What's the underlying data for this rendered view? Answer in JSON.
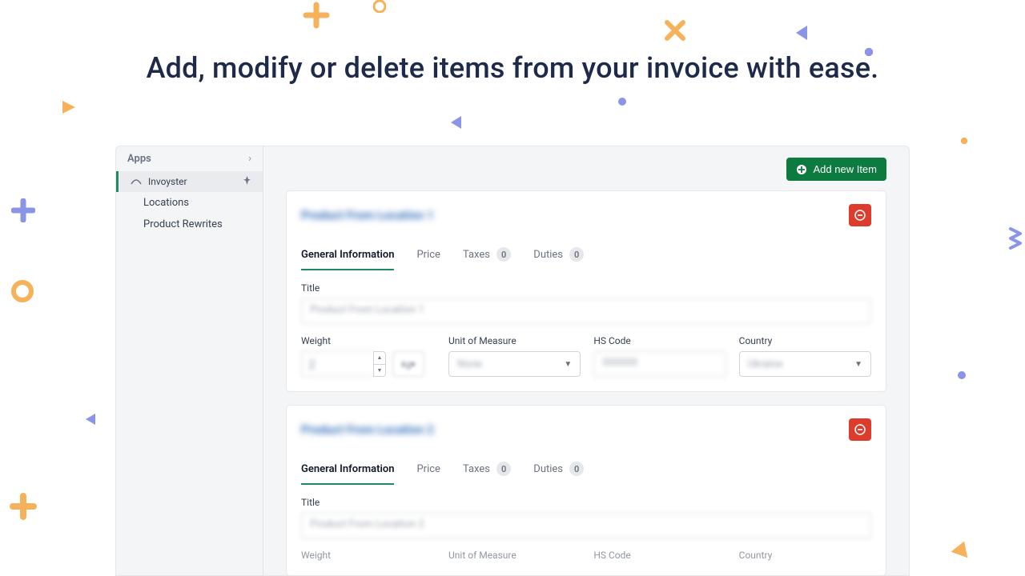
{
  "headline": "Add, modify or delete items from your invoice with ease.",
  "sidebar": {
    "header": "Apps",
    "items": [
      {
        "label": "Invoyster",
        "active": true
      },
      {
        "label": "Locations",
        "active": false
      },
      {
        "label": "Product Rewrites",
        "active": false
      }
    ]
  },
  "toolbar": {
    "add_label": "Add new Item"
  },
  "tabs": {
    "general": "General Information",
    "price": "Price",
    "taxes": "Taxes",
    "taxes_count": "0",
    "duties": "Duties",
    "duties_count": "0"
  },
  "fields": {
    "title": "Title",
    "weight": "Weight",
    "uom": "Unit of Measure",
    "hs": "HS Code",
    "country": "Country"
  }
}
